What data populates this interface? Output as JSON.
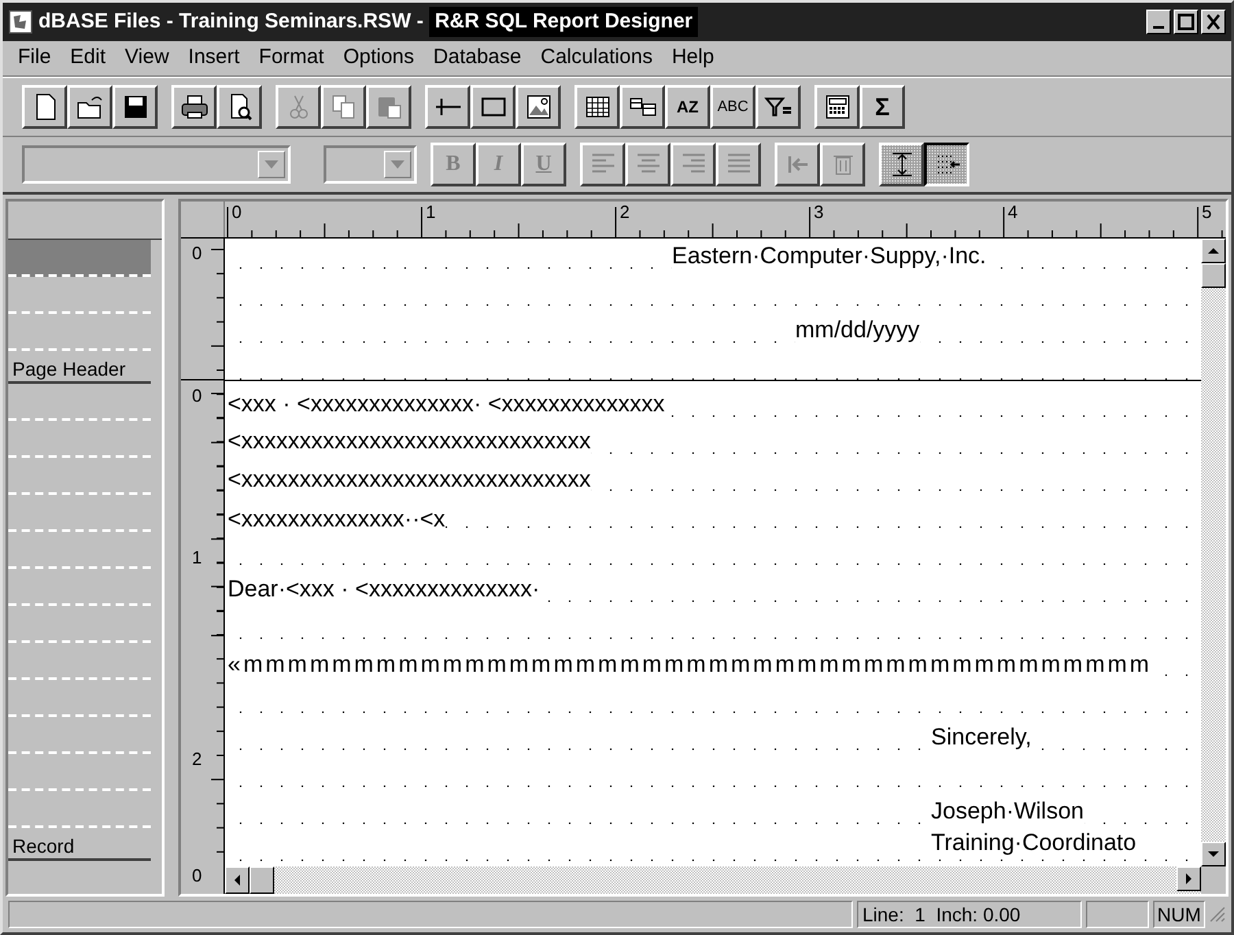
{
  "window": {
    "title": "dBASE Files - Training Seminars.RSW - ",
    "app_name": "R&R SQL Report Designer"
  },
  "menu": [
    {
      "label": "File"
    },
    {
      "label": "Edit"
    },
    {
      "label": "View"
    },
    {
      "label": "Insert"
    },
    {
      "label": "Format"
    },
    {
      "label": "Options"
    },
    {
      "label": "Database"
    },
    {
      "label": "Calculations"
    },
    {
      "label": "Help"
    }
  ],
  "toolbar": [
    [
      {
        "disabled": false
      },
      {
        "disabled": false
      },
      {
        "disabled": false
      }
    ],
    [
      {
        "disabled": false
      },
      {
        "disabled": false
      }
    ],
    [
      {
        "disabled": true
      },
      {
        "disabled": true
      },
      {
        "disabled": true
      }
    ],
    [
      {
        "disabled": false
      },
      {
        "disabled": false
      },
      {
        "disabled": false
      }
    ],
    [
      {
        "disabled": false
      },
      {
        "disabled": false
      },
      {
        "label": "AZ",
        "disabled": false
      },
      {
        "label": "ABC",
        "disabled": false
      },
      {
        "disabled": false
      }
    ],
    [
      {
        "disabled": false
      },
      {
        "label": "Σ",
        "disabled": false
      }
    ]
  ],
  "format_bar": {
    "buttons": [
      [
        {
          "label": "B",
          "disabled": true
        },
        {
          "label": "I",
          "disabled": true
        },
        {
          "label": "U",
          "disabled": true
        }
      ],
      [
        {
          "disabled": true
        },
        {
          "disabled": true
        },
        {
          "disabled": true
        },
        {
          "disabled": true
        }
      ],
      [
        {
          "disabled": true
        },
        {
          "disabled": true
        }
      ],
      [
        {
          "pressed": false
        },
        {
          "pressed": true
        }
      ]
    ]
  },
  "ruler": {
    "labels": [
      "0",
      "1",
      "2",
      "3",
      "4",
      "5"
    ],
    "vertical_labels": [
      "0",
      "0",
      "1",
      "2",
      "0"
    ]
  },
  "bands": [
    {
      "name": "Page Header",
      "selected": true
    },
    {
      "name": "Record",
      "selected": false
    }
  ],
  "report_lines": [
    {
      "text": "Eastern·Computer·Suppy,·Inc."
    },
    {
      "text": "mm/dd/yyyy"
    },
    {
      "text": "<xxx · <xxxxxxxxxxxxxx· <xxxxxxxxxxxxxx"
    },
    {
      "text": "<xxxxxxxxxxxxxxxxxxxxxxxxxxxxxx"
    },
    {
      "text": "<xxxxxxxxxxxxxxxxxxxxxxxxxxxxxx"
    },
    {
      "text": "<xxxxxxxxxxxxxx··<x"
    },
    {
      "text": "Dear·<xxx · <xxxxxxxxxxxxxx·"
    },
    {
      "text": "«mmmmmmmmmmmmmmmmmmmmmmmmmmmmmmmmmmmmmmmmm"
    },
    {
      "text": "Sincerely,"
    },
    {
      "text": "Joseph·Wilson"
    },
    {
      "text": "Training·Coordinato"
    }
  ],
  "status_bar": {
    "position": "Line:  1  Inch: 0.00",
    "num": "NUM"
  }
}
